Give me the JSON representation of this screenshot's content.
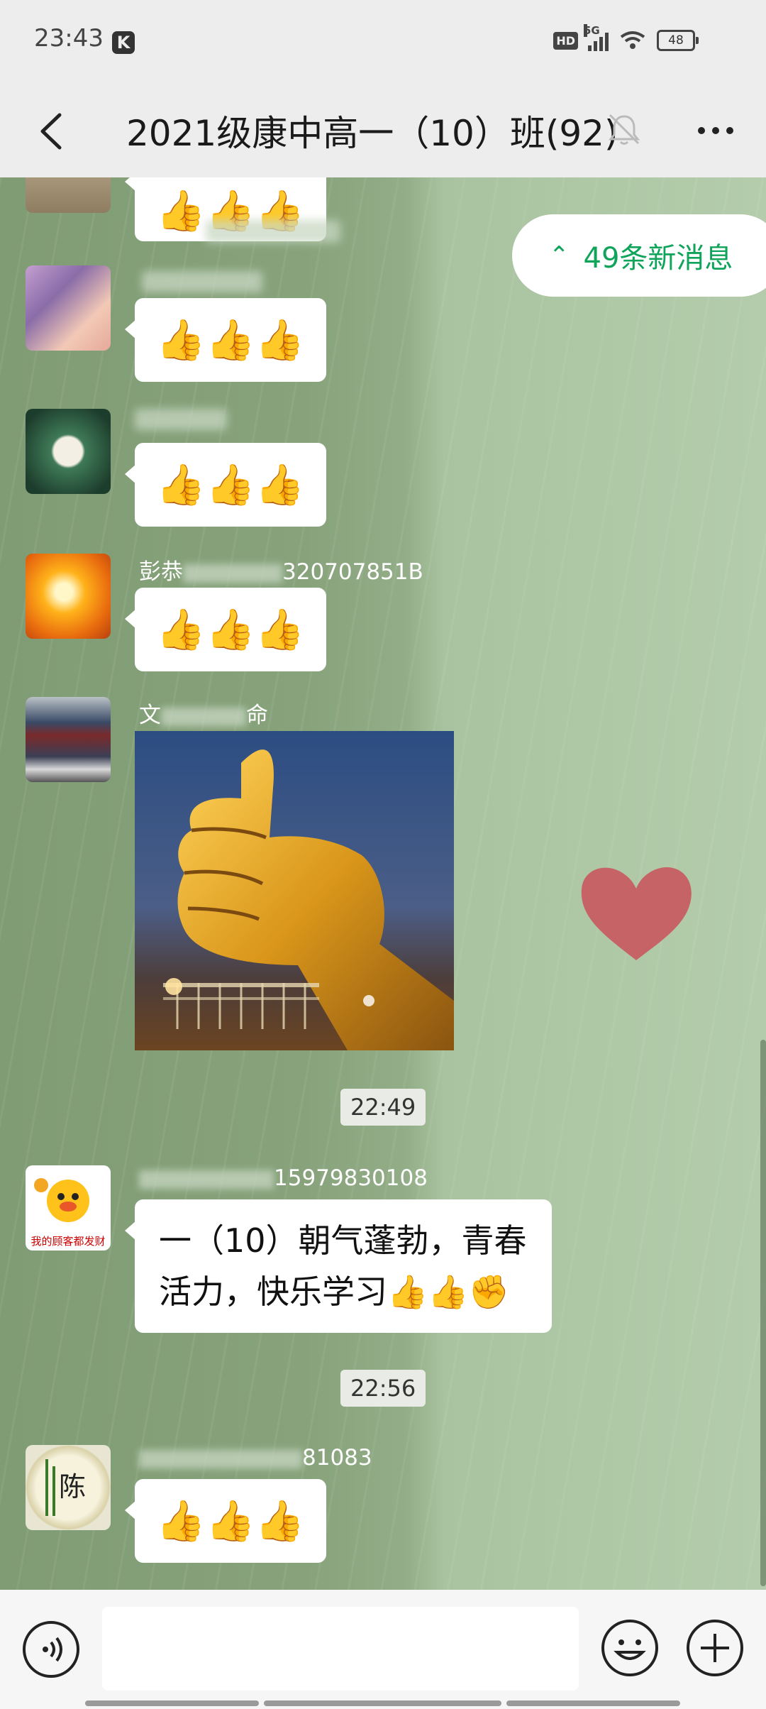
{
  "status_bar": {
    "time": "23:43",
    "app_badge": "K",
    "hd_label": "HD",
    "network_label": "5G",
    "battery_level": "48",
    "icons": [
      "k-app-icon",
      "hd-icon",
      "signal-icon",
      "wifi-icon",
      "battery-icon"
    ]
  },
  "header": {
    "title": "2021级康中高一（10）班(92)",
    "icons": [
      "back-icon",
      "mute-bell-icon",
      "more-icon"
    ]
  },
  "new_messages": {
    "label": "49条新消息",
    "icon": "double-chevron-up-icon"
  },
  "messages": [
    {
      "type": "emoji",
      "content": "👍👍👍"
    },
    {
      "type": "emoji",
      "content": "👍👍👍"
    },
    {
      "type": "emoji",
      "content": "👍👍👍"
    },
    {
      "type": "emoji",
      "sender_visible": "彭恭",
      "sender_suffix": "320707851B",
      "content": "👍👍👍"
    },
    {
      "type": "image",
      "sender_visible": "文",
      "sender_suffix": "命"
    },
    {
      "type": "timestamp",
      "content": "22:49"
    },
    {
      "type": "text",
      "sender_suffix": "15979830108",
      "avatar_text": "我的顾客都发财",
      "content": "一（10）朝气蓬勃，青春活力，快乐学习👍👍✊"
    },
    {
      "type": "timestamp",
      "content": "22:56"
    },
    {
      "type": "emoji",
      "sender_suffix": "81083",
      "avatar_text": "陈",
      "content": "👍👍👍"
    }
  ],
  "input_bar": {
    "icons": [
      "voice-icon",
      "emoji-icon",
      "plus-icon"
    ]
  },
  "colors": {
    "accent": "#10a45a",
    "bubble": "#ffffff",
    "header_bg": "#ededed"
  }
}
